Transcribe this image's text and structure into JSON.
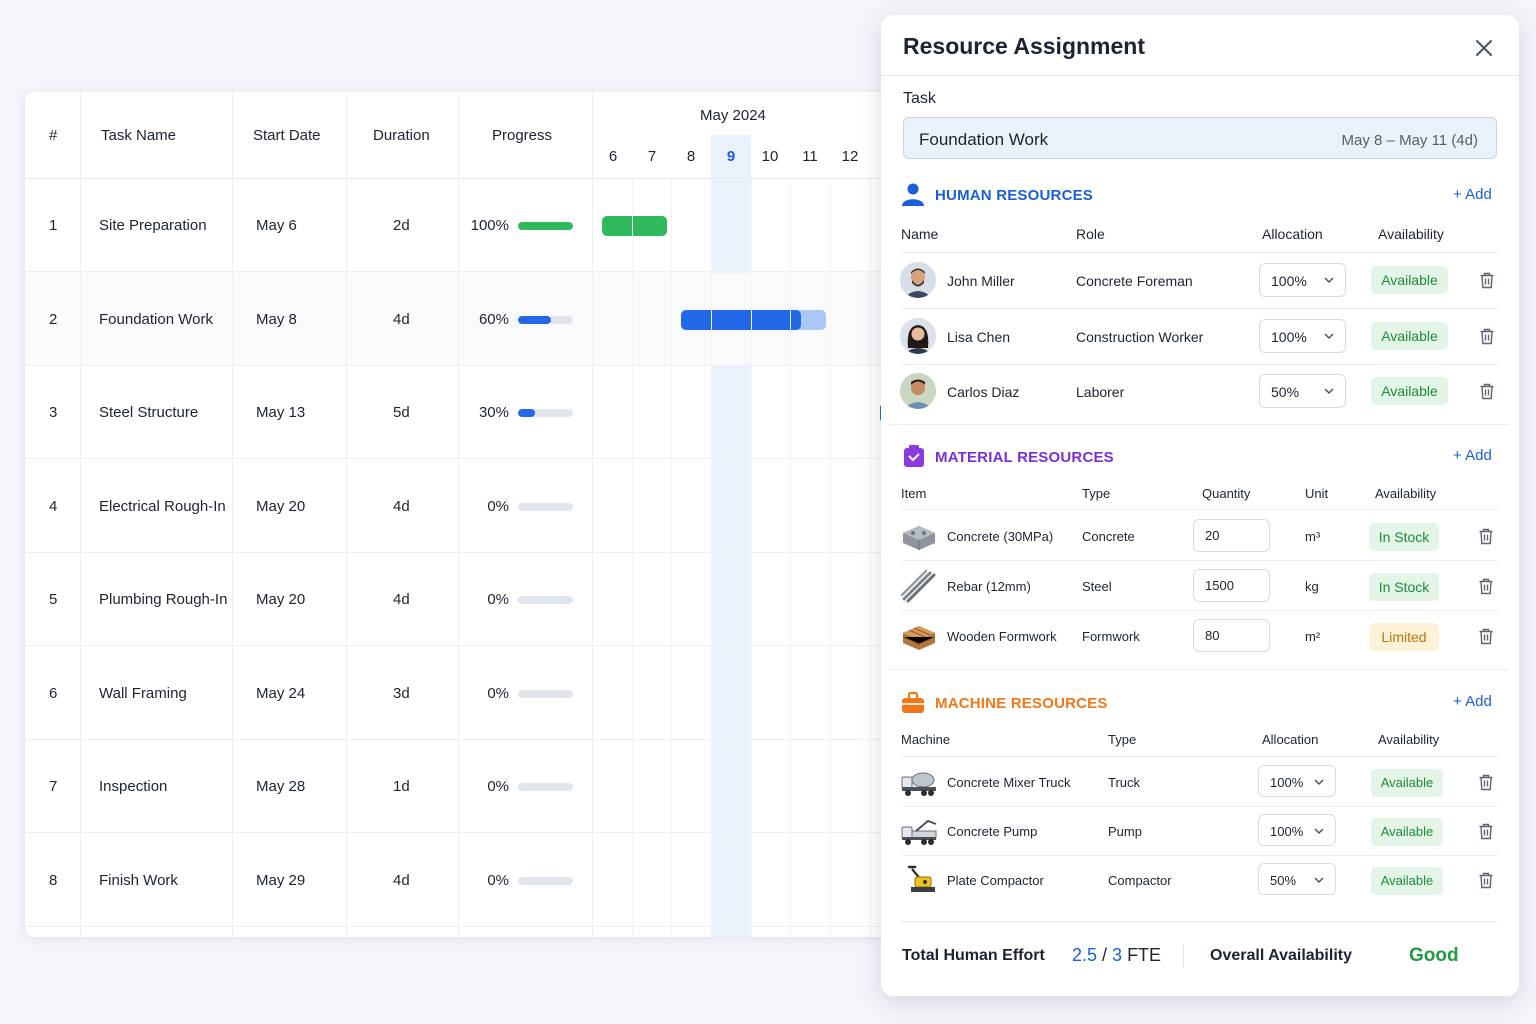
{
  "gantt": {
    "headers": {
      "num": "#",
      "task": "Task Name",
      "start": "Start Date",
      "duration": "Duration",
      "progress": "Progress"
    },
    "month": "May 2024",
    "days": [
      "6",
      "7",
      "8",
      "9",
      "10",
      "11",
      "12"
    ],
    "today": "9",
    "rows": [
      {
        "num": "1",
        "name": "Site Preparation",
        "start": "May 6",
        "duration": "2d",
        "progress_label": "100%",
        "progress": 100,
        "bar_color": "#2fb85c",
        "status": "done"
      },
      {
        "num": "2",
        "name": "Foundation Work",
        "start": "May 8",
        "duration": "4d",
        "progress_label": "60%",
        "progress": 60,
        "bar_color": "#2368e8",
        "status": "active"
      },
      {
        "num": "3",
        "name": "Steel Structure",
        "start": "May 13",
        "duration": "5d",
        "progress_label": "30%",
        "progress": 30,
        "bar_color": "#2368e8",
        "status": "active"
      },
      {
        "num": "4",
        "name": "Electrical Rough-In",
        "start": "May 20",
        "duration": "4d",
        "progress_label": "0%",
        "progress": 0,
        "bar_color": "#cdd3dc",
        "status": "pending"
      },
      {
        "num": "5",
        "name": "Plumbing Rough-In",
        "start": "May 20",
        "duration": "4d",
        "progress_label": "0%",
        "progress": 0,
        "bar_color": "#cdd3dc",
        "status": "pending"
      },
      {
        "num": "6",
        "name": "Wall Framing",
        "start": "May 24",
        "duration": "3d",
        "progress_label": "0%",
        "progress": 0,
        "bar_color": "#cdd3dc",
        "status": "pending"
      },
      {
        "num": "7",
        "name": "Inspection",
        "start": "May 28",
        "duration": "1d",
        "progress_label": "0%",
        "progress": 0,
        "bar_color": "#cdd3dc",
        "status": "pending"
      },
      {
        "num": "8",
        "name": "Finish Work",
        "start": "May 29",
        "duration": "4d",
        "progress_label": "0%",
        "progress": 0,
        "bar_color": "#cdd3dc",
        "status": "pending"
      }
    ]
  },
  "panel": {
    "title": "Resource Assignment",
    "task_label": "Task",
    "task_name": "Foundation Work",
    "task_dates": "May 8 – May 11 (4d)",
    "add_label": "+ Add",
    "human": {
      "title": "HUMAN RESOURCES",
      "color": "#1a5fd8",
      "headers": {
        "name": "Name",
        "role": "Role",
        "allocation": "Allocation",
        "availability": "Availability"
      },
      "rows": [
        {
          "name": "John Miller",
          "role": "Concrete Foreman",
          "allocation": "100%",
          "availability": "Available"
        },
        {
          "name": "Lisa Chen",
          "role": "Construction Worker",
          "allocation": "100%",
          "availability": "Available"
        },
        {
          "name": "Carlos Diaz",
          "role": "Laborer",
          "allocation": "50%",
          "availability": "Available"
        }
      ]
    },
    "material": {
      "title": "MATERIAL RESOURCES",
      "color": "#7b2fd6",
      "headers": {
        "item": "Item",
        "type": "Type",
        "quantity": "Quantity",
        "unit": "Unit",
        "availability": "Availability"
      },
      "rows": [
        {
          "item": "Concrete (30MPa)",
          "type": "Concrete",
          "quantity": "20",
          "unit": "m³",
          "availability": "In Stock",
          "status": "green",
          "icon": "concrete-block-icon"
        },
        {
          "item": "Rebar (12mm)",
          "type": "Steel",
          "quantity": "1500",
          "unit": "kg",
          "availability": "In Stock",
          "status": "green",
          "icon": "rebar-icon"
        },
        {
          "item": "Wooden Formwork",
          "type": "Formwork",
          "quantity": "80",
          "unit": "m²",
          "availability": "Limited",
          "status": "amber",
          "icon": "wood-planks-icon"
        }
      ]
    },
    "machine": {
      "title": "MACHINE RESOURCES",
      "color": "#f07818",
      "headers": {
        "machine": "Machine",
        "type": "Type",
        "allocation": "Allocation",
        "availability": "Availability"
      },
      "rows": [
        {
          "machine": "Concrete Mixer Truck",
          "type": "Truck",
          "allocation": "100%",
          "availability": "Available",
          "icon": "mixer-truck-icon"
        },
        {
          "machine": "Concrete Pump",
          "type": "Pump",
          "allocation": "100%",
          "availability": "Available",
          "icon": "concrete-pump-icon"
        },
        {
          "machine": "Plate Compactor",
          "type": "Compactor",
          "allocation": "50%",
          "availability": "Available",
          "icon": "plate-compactor-icon"
        }
      ]
    },
    "footer": {
      "effort_label": "Total Human Effort",
      "effort_value": "2.5",
      "effort_sep": " / ",
      "effort_total": "3",
      "effort_unit": " FTE",
      "overall_label": "Overall Availability",
      "overall_value": "Good"
    }
  }
}
